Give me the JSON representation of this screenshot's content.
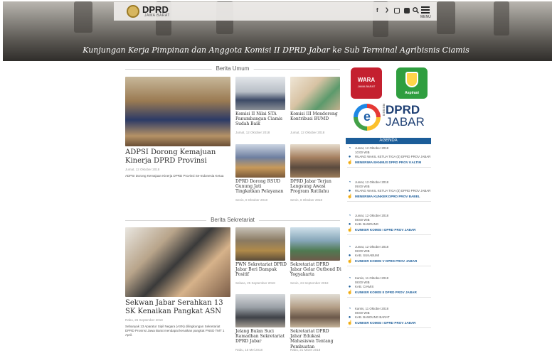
{
  "header": {
    "logo_title": "DPRD",
    "logo_subtitle": "JAWA BARAT",
    "social": [
      "f",
      "t",
      "ig",
      "yt"
    ],
    "search_icon": "search-icon",
    "menu_label": "MENU",
    "hero_title": "Kunjungan Kerja Pimpinan dan Anggota Komisi II DPRD Jabar ke Sub Terminal Agribisnis Ciamis"
  },
  "berita_umum": {
    "heading": "Berita Umum",
    "featured": {
      "title": "ADPSI Dorong Kemajuan Kinerja DPRD Provinsi",
      "date": "Jumat, 12 Oktober 2018",
      "excerpt": "ADPSI Dorong Kemajuan Kinerja DPRD Provinsi Se-Indonesia Ketua"
    },
    "items": [
      {
        "title": "Komisi II Nilai STA Panumbangan Ciamis Sudah Baik",
        "date": "Jumat, 12 Oktober 2018"
      },
      {
        "title": "Komisi III Mendorong Kontribusi BUMD",
        "date": "Jumat, 12 Oktober 2018"
      },
      {
        "title": "DPRD Dorong RSUD Gunung Jati Tingkatkan Pelayanan",
        "date": "Senin, 8 Oktober 2018"
      },
      {
        "title": "DPRD Jabar Terjun Langsung Awasi Program Rutilahu",
        "date": "Senin, 8 Oktober 2018"
      }
    ]
  },
  "berita_sekretariat": {
    "heading": "Berita Sekretariat",
    "featured": {
      "title": "Sekwan Jabar Serahkan 13 SK Kenaikan Pangkat ASN",
      "date": "Rabu, 26 September 2018",
      "excerpt": "Sebanyak 13 Aparatur Sipil Negara (ASN) dilingkungan Sekretariat DPRD Provinsi Jawa Barat mendapat kenaikan pangkat PNSD TMT 1 April."
    },
    "items": [
      {
        "title": "PWN Sekretariat DPRD Jabar Beri Dampak Positif",
        "date": "Selasa, 25 September 2018"
      },
      {
        "title": "Sekretariat DPRD Jabar Gelar Outbond Di Yogyakarta",
        "date": "Senin, 24 September 2018"
      },
      {
        "title": "Jelang Bulan Suci Ramadhan Sekretariat DPRD Jabar",
        "date": "Rabu, 16 Mei 2018"
      },
      {
        "title": "Sekretariat DPRD Jabar Edukasi Mahasiswa Tentang Pembuatan",
        "date": "Rabu, 21 Maret 2018"
      }
    ]
  },
  "sidebar": {
    "wara_top": "WARA",
    "wara_bottom": "JAWA BARAT",
    "aspirasi_label": "Aspirasi",
    "reses_e": "e",
    "reses_vertical": "RESES",
    "reses_line1": "DPRD",
    "reses_line2": "JABAR",
    "agenda_title": "AGENDA",
    "agenda": [
      {
        "date": "Jumat, 12 Oktober 2018",
        "time": "10:00 WIB",
        "place": "RUANG WAKIL KETUA TIGA (3) DPRD PROV JABAR",
        "event": "MENERIMA BANMUS DPRD PROV KALTIM"
      },
      {
        "date": "Jumat, 12 Oktober 2018",
        "time": "09:00 WIB",
        "place": "RUANG WAKIL KETUA TIGA (3) DPRD PROV JABAR",
        "event": "MENERIMA KUNKER DPRD PROV BABEL"
      },
      {
        "date": "Jumat, 12 Oktober 2018",
        "time": "08:00 WIB",
        "place": "KAB. BANDUNG",
        "event": "KUNKER KOMISI I DPRD PROV JABAR"
      },
      {
        "date": "Jumat, 12 Oktober 2018",
        "time": "08:00 WIB",
        "place": "KAB. SUKABUMI",
        "event": "KUNKER KOMISI V DPRD PROV JABAR"
      },
      {
        "date": "Kamis, 11 Oktober 2018",
        "time": "08:00 WIB",
        "place": "KAB. CIAMIS",
        "event": "KUNKER KOMISI II DPRD PROV JABAR"
      },
      {
        "date": "Kamis, 11 Oktober 2018",
        "time": "08:00 WIB",
        "place": "KAB. BANDUNG BARAT",
        "event": "KUNKER KOMISI I DPRD PROV JABAR"
      }
    ]
  }
}
